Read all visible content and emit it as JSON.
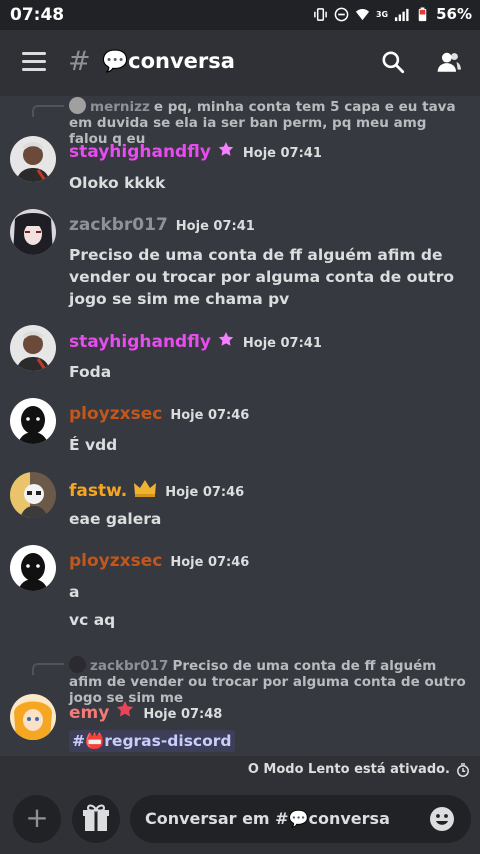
{
  "status_bar": {
    "time": "07:48",
    "battery": "56%",
    "network": "3G"
  },
  "header": {
    "hash": "#",
    "channel": "💬conversa"
  },
  "messages": [
    {
      "reply": {
        "author": "mernizz",
        "text": "e pq, minha conta tem 5 capa e eu tava em duvida se ela ia ser ban perm, pq meu amg falou q eu"
      },
      "author": "stayhighandfly",
      "time": "Hoje 07:41",
      "lines": [
        "Oloko kkkk"
      ]
    },
    {
      "author": "zackbr017",
      "time": "Hoje 07:41",
      "lines": [
        "Preciso de uma conta de ff alguém afim de vender ou trocar por alguma conta de outro jogo se sim me chama pv"
      ]
    },
    {
      "author": "stayhighandfly",
      "time": "Hoje 07:41",
      "lines": [
        "Foda"
      ]
    },
    {
      "author": "ployzxsec",
      "time": "Hoje 07:46",
      "lines": [
        "É vdd"
      ]
    },
    {
      "author": "fastw.",
      "time": "Hoje 07:46",
      "lines": [
        "eae galera"
      ]
    },
    {
      "author": "ployzxsec",
      "time": "Hoje 07:46",
      "lines": [
        "a",
        "vc aq"
      ]
    },
    {
      "reply": {
        "author": "zackbr017",
        "text": "Preciso de uma conta de ff alguém afim de vender ou trocar por alguma conta de outro jogo se sim me"
      },
      "author": "emy",
      "time": "Hoje 07:48",
      "mention": "#📛regras-discord"
    }
  ],
  "slowmode": "O Modo Lento está ativado.",
  "composer": {
    "placeholder": "Conversar em #💬conversa",
    "add": "+"
  },
  "colors": {
    "stayhighandfly": "#e84bef",
    "zackbr017": "#8e9297",
    "ployzxsec": "#c1571a",
    "fastw": "#f4a623",
    "emy": "#f47a7a",
    "background": "#36393f"
  },
  "icons": [
    "hamburger-icon",
    "search-icon",
    "members-icon",
    "booster-badge-icon",
    "crown-icon",
    "slowmode-clock-icon",
    "gift-icon",
    "emoji-icon"
  ]
}
